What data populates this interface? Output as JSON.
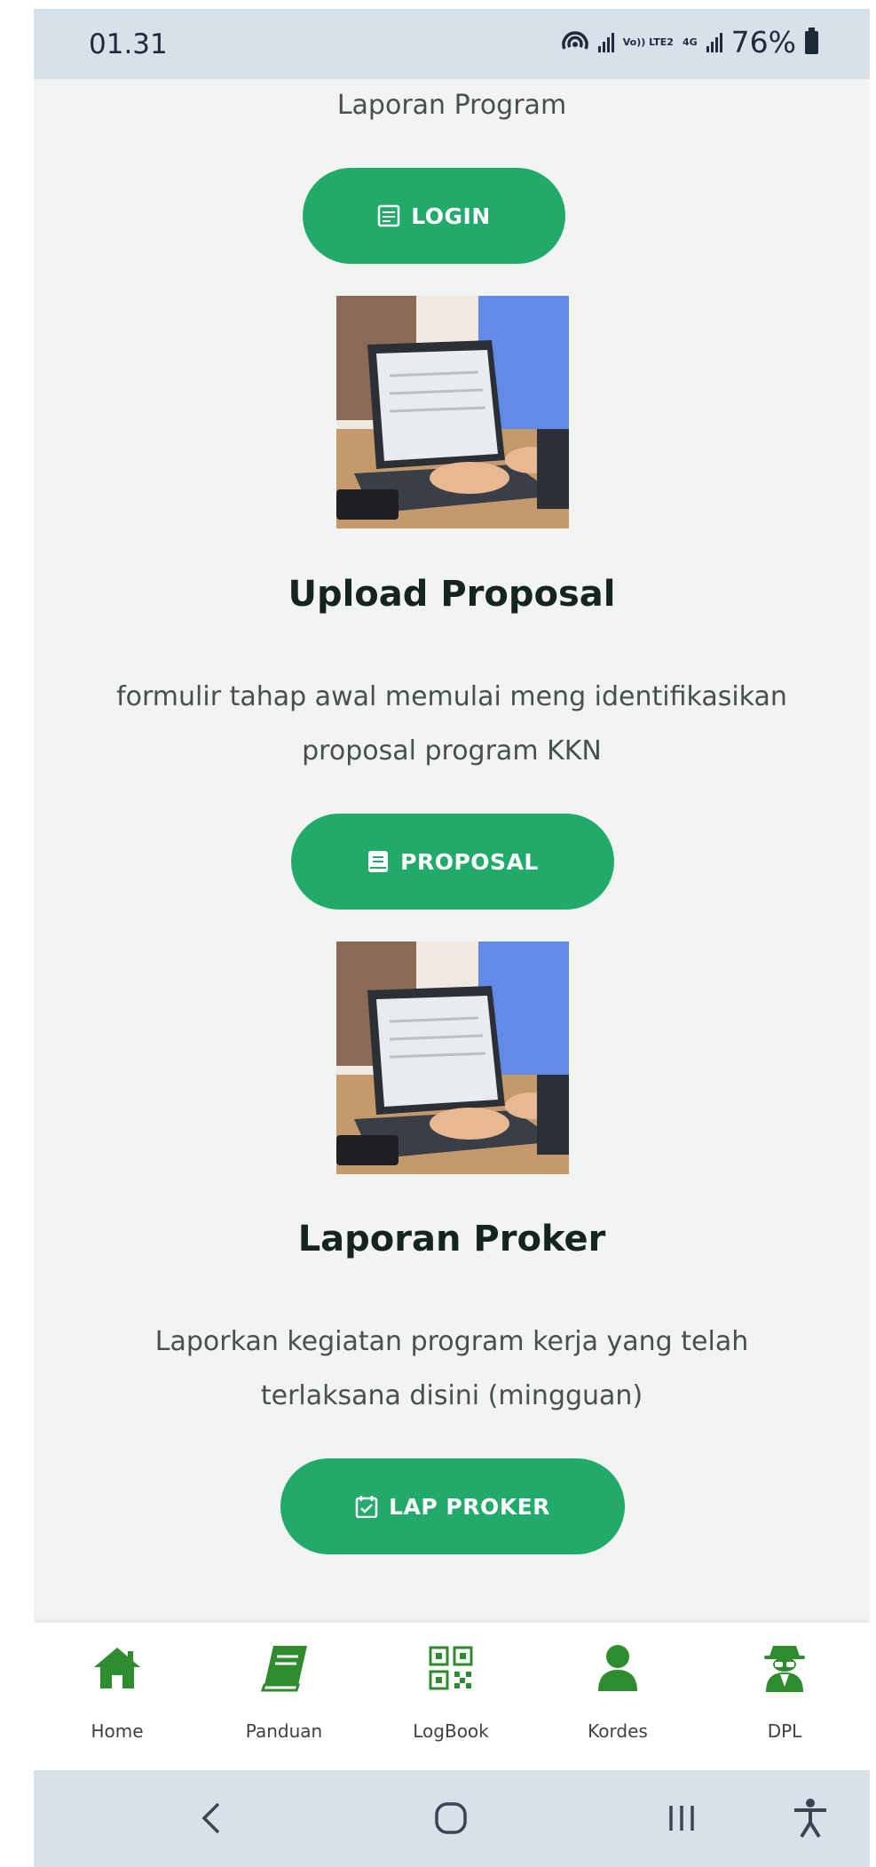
{
  "status_bar": {
    "time": "01.31",
    "network": "Vo)) LTE2",
    "network_gen": "4G",
    "battery": "76%"
  },
  "content": {
    "top_text": "Laporan Program",
    "login_button": "LOGIN",
    "sections": [
      {
        "title": "Upload Proposal",
        "desc_line1": "formulir tahap awal memulai meng identifikasikan",
        "desc_line2": "proposal program KKN",
        "button": "PROPOSAL"
      },
      {
        "title": "Laporan Proker",
        "desc_line1": "Laporkan kegiatan program kerja yang telah",
        "desc_line2": "terlaksana disini (mingguan)",
        "button": "LAP PROKER"
      }
    ]
  },
  "bottom_nav": [
    {
      "label": "Home",
      "icon": "home-icon"
    },
    {
      "label": "Panduan",
      "icon": "book-icon"
    },
    {
      "label": "LogBook",
      "icon": "qr-code-icon"
    },
    {
      "label": "Kordes",
      "icon": "user-icon"
    },
    {
      "label": "DPL",
      "icon": "user-secret-icon"
    }
  ],
  "colors": {
    "accent": "#21aa69",
    "nav_icon": "#2e8b2e",
    "status_bg": "#d8e1ea",
    "page_bg": "#f2f4f2"
  }
}
